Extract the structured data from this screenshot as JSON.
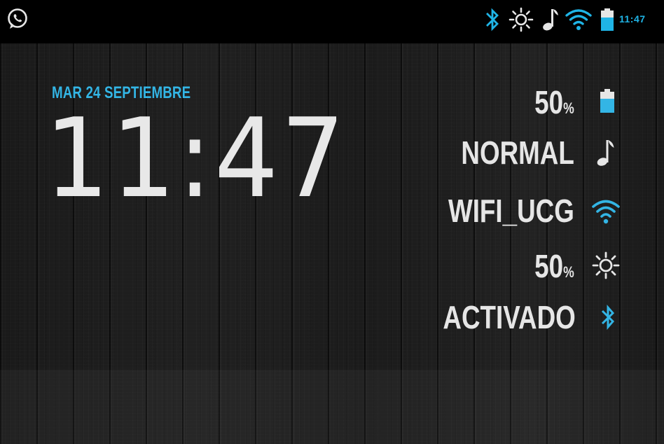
{
  "status_bar": {
    "notification_icon": "whatsapp-icon",
    "icons": [
      "bluetooth-icon",
      "brightness-icon",
      "music-note-icon",
      "wifi-icon",
      "battery-icon"
    ],
    "time": "11:47"
  },
  "clock_widget": {
    "date": "MAR 24 SEPTIEMBRE",
    "time": "11:47"
  },
  "info_panel": {
    "battery": {
      "value": "50",
      "unit": "%",
      "icon": "battery-icon"
    },
    "sound_mode": {
      "value": "NORMAL",
      "icon": "music-note-icon"
    },
    "wifi": {
      "value": "WIFI_UCG",
      "icon": "wifi-icon"
    },
    "brightness": {
      "value": "50",
      "unit": "%",
      "icon": "brightness-icon"
    },
    "bluetooth": {
      "value": "ACTIVADO",
      "icon": "bluetooth-icon"
    }
  },
  "colors": {
    "accent": "#33b5e5",
    "text": "#e6e6e6",
    "background": "#161616"
  }
}
